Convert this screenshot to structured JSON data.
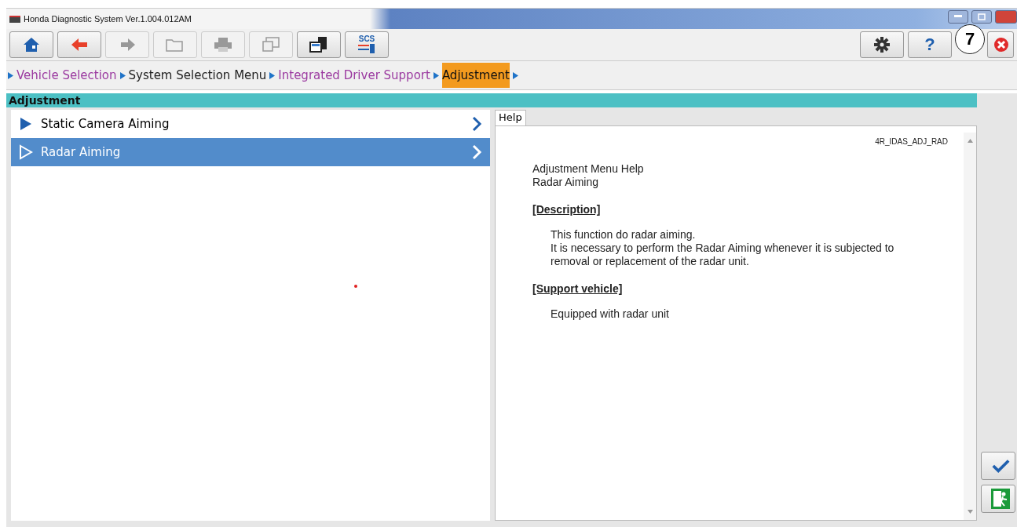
{
  "window": {
    "title": "Honda Diagnostic System Ver.1.004.012AM"
  },
  "toolbar": {
    "left": [
      {
        "kind": "home",
        "disabled": false
      },
      {
        "kind": "back",
        "disabled": false
      },
      {
        "kind": "forward",
        "disabled": true
      },
      {
        "kind": "folder",
        "disabled": true
      },
      {
        "kind": "print",
        "disabled": true
      },
      {
        "kind": "window",
        "disabled": true
      },
      {
        "kind": "copy",
        "disabled": false
      },
      {
        "kind": "scs",
        "label": "SCS",
        "disabled": false
      }
    ],
    "right": [
      {
        "kind": "settings",
        "disabled": false
      },
      {
        "kind": "help",
        "label": "?",
        "disabled": false
      },
      {
        "kind": "close",
        "disabled": false
      }
    ]
  },
  "callout": "7",
  "breadcrumb": [
    {
      "label": "Vehicle Selection",
      "visited": true,
      "selected": false
    },
    {
      "label": "System Selection Menu",
      "visited": false,
      "selected": false
    },
    {
      "label": "Integrated Driver Support",
      "visited": true,
      "selected": false
    },
    {
      "label": "Adjustment",
      "visited": false,
      "selected": true
    }
  ],
  "section_title": "Adjustment",
  "menu": [
    {
      "label": "Static Camera Aiming",
      "selected": false
    },
    {
      "label": "Radar Aiming",
      "selected": true
    }
  ],
  "help": {
    "tab": "Help",
    "code": "4R_IDAS_ADJ_RAD",
    "heading": [
      "Adjustment Menu Help",
      "Radar Aiming"
    ],
    "sections": [
      {
        "title": "[Description]",
        "lines": [
          "This function do radar aiming.",
          "It is necessary to perform the Radar Aiming whenever it is subjected to removal or replacement of the radar unit."
        ]
      },
      {
        "title": "[Support vehicle]",
        "lines": [
          "Equipped with radar unit"
        ]
      }
    ]
  },
  "side_buttons": [
    {
      "kind": "ok"
    },
    {
      "kind": "exit"
    }
  ]
}
